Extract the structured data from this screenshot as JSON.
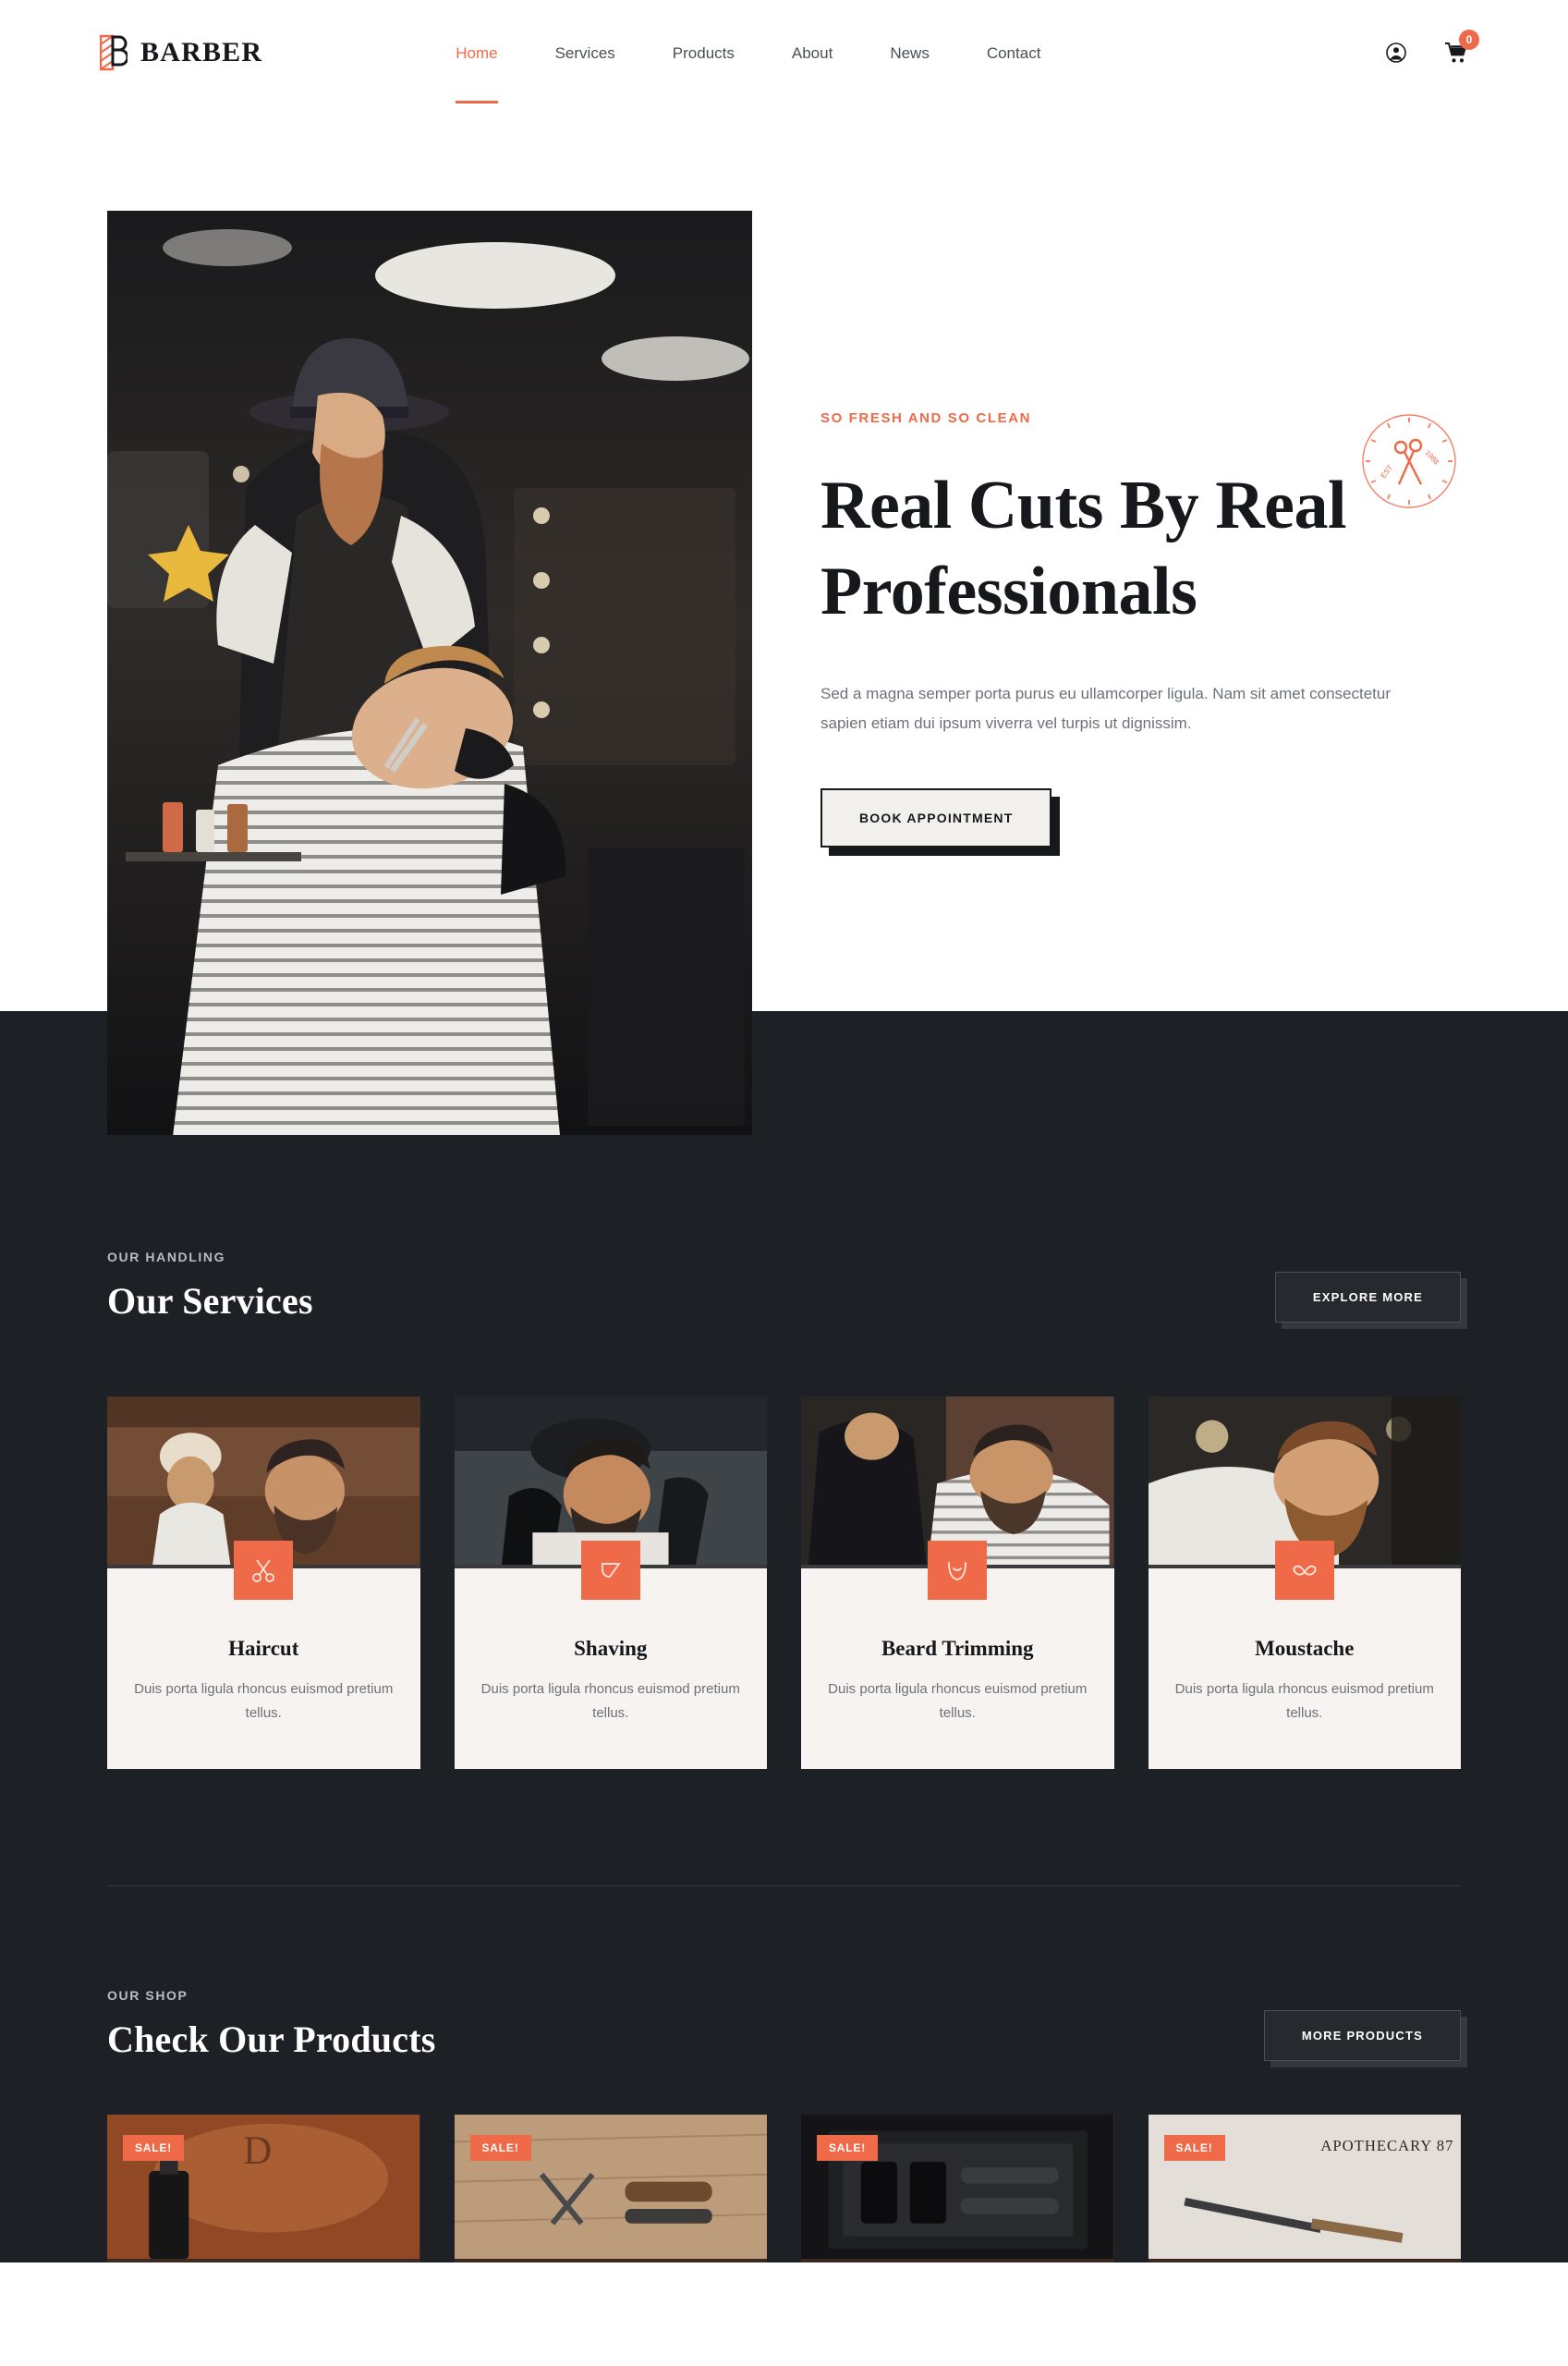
{
  "header": {
    "logo_icon": "barber-pole-icon",
    "brand": "BARBER",
    "nav": [
      {
        "label": "Home",
        "active": true
      },
      {
        "label": "Services",
        "active": false
      },
      {
        "label": "Products",
        "active": false
      },
      {
        "label": "About",
        "active": false
      },
      {
        "label": "News",
        "active": false
      },
      {
        "label": "Contact",
        "active": false
      }
    ],
    "account_icon": "user-account-icon",
    "cart_icon": "shopping-cart-icon",
    "cart_count": "0"
  },
  "hero": {
    "eyebrow": "SO FRESH AND SO CLEAN",
    "title": "Real Cuts By Real Professionals",
    "paragraph": "Sed a magna semper porta purus eu ullamcorper ligula. Nam sit amet consectetur sapien etiam dui ipsum viverra vel turpis ut dignissim.",
    "cta": "BOOK APPOINTMENT",
    "stamp_icon": "scissors-stamp-icon",
    "stamp_text_left": "EST",
    "stamp_text_right": "1988",
    "photo_alt": "barber-shaving-client-photo"
  },
  "services": {
    "kicker": "OUR HANDLING",
    "title": "Our Services",
    "cta": "EXPLORE MORE",
    "items": [
      {
        "title": "Haircut",
        "text": "Duis porta ligula rhoncus euismod pretium tellus.",
        "icon": "scissors-icon"
      },
      {
        "title": "Shaving",
        "text": "Duis porta ligula rhoncus euismod pretium tellus.",
        "icon": "razor-icon"
      },
      {
        "title": "Beard Trimming",
        "text": "Duis porta ligula rhoncus euismod pretium tellus.",
        "icon": "beard-icon"
      },
      {
        "title": "Moustache",
        "text": "Duis porta ligula rhoncus euismod pretium tellus.",
        "icon": "moustache-icon"
      }
    ]
  },
  "shop": {
    "kicker": "OUR SHOP",
    "title": "Check Our Products",
    "cta": "MORE PRODUCTS",
    "items": [
      {
        "badge": "SALE!",
        "alt": "beard-oil-product-photo"
      },
      {
        "badge": "SALE!",
        "alt": "shaving-tools-product-photo"
      },
      {
        "badge": "SALE!",
        "alt": "grooming-kit-product-photo"
      },
      {
        "badge": "SALE!",
        "alt": "apothecary-razor-product-photo"
      }
    ]
  },
  "colors": {
    "accent": "#ef6a48",
    "dark": "#1d2024",
    "card_bg": "#f6f3f0",
    "text_muted": "#6d7178"
  }
}
